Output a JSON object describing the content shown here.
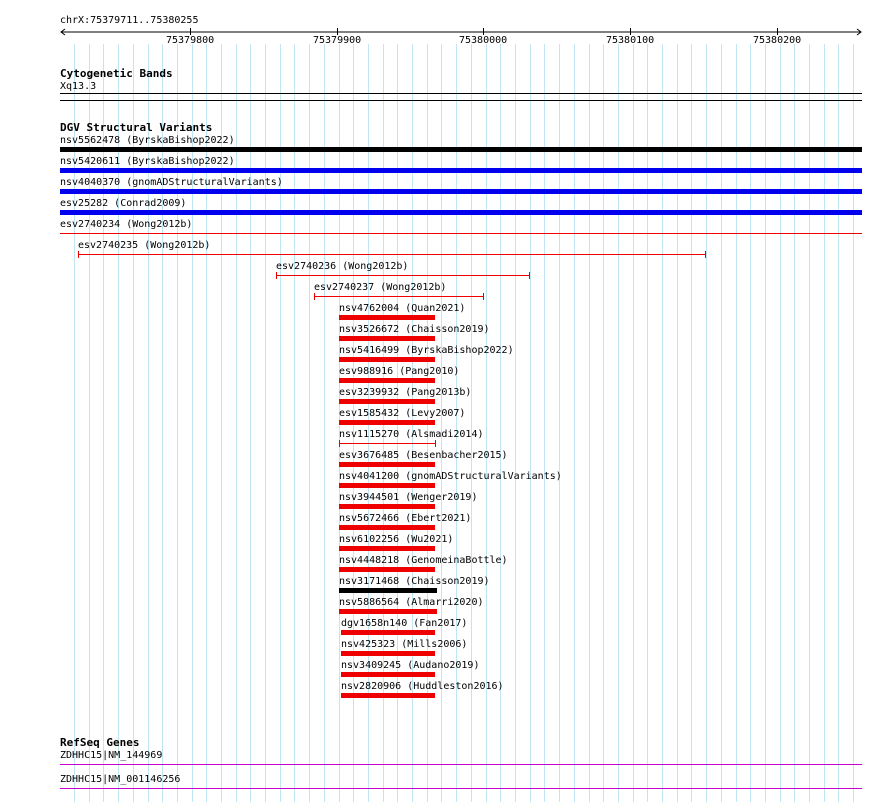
{
  "ruler": {
    "region": "chrX:75379711..75380255",
    "ticks": [
      "75379800",
      "75379900",
      "75380000",
      "75380100",
      "75380200"
    ]
  },
  "cytoband": {
    "title": "Cytogenetic Bands",
    "band": "Xq13.3"
  },
  "dgv": {
    "title": "DGV Structural Variants",
    "variants": [
      {
        "label": "nsv5562478 (ByrskaBishop2022)",
        "color": "#000000",
        "style": "thick"
      },
      {
        "label": "nsv5420611 (ByrskaBishop2022)",
        "color": "#0000ee",
        "style": "thick"
      },
      {
        "label": "nsv4040370 (gnomADStructuralVariants)",
        "color": "#0000ee",
        "style": "thick"
      },
      {
        "label": "esv25282 (Conrad2009)",
        "color": "#0000ee",
        "style": "thick"
      },
      {
        "label": "esv2740234 (Wong2012b)",
        "color": "#ee0000",
        "style": "line"
      },
      {
        "label": "esv2740235 (Wong2012b)",
        "color": "#ee0000",
        "style": "capped"
      },
      {
        "label": "esv2740236 (Wong2012b)",
        "color": "#ee0000",
        "style": "capped"
      },
      {
        "label": "esv2740237 (Wong2012b)",
        "color": "#ee0000",
        "style": "capped"
      },
      {
        "label": "nsv4762004 (Quan2021)",
        "color": "#ee0000",
        "style": "thick"
      },
      {
        "label": "nsv3526672 (Chaisson2019)",
        "color": "#ee0000",
        "style": "thick"
      },
      {
        "label": "nsv5416499 (ByrskaBishop2022)",
        "color": "#ee0000",
        "style": "thick"
      },
      {
        "label": "esv988916 (Pang2010)",
        "color": "#ee0000",
        "style": "thick"
      },
      {
        "label": "esv3239932 (Pang2013b)",
        "color": "#ee0000",
        "style": "thick"
      },
      {
        "label": "esv1585432 (Levy2007)",
        "color": "#ee0000",
        "style": "thick"
      },
      {
        "label": "nsv1115270 (Alsmadi2014)",
        "color": "#ee0000",
        "style": "capped"
      },
      {
        "label": "esv3676485 (Besenbacher2015)",
        "color": "#ee0000",
        "style": "thick"
      },
      {
        "label": "nsv4041200 (gnomADStructuralVariants)",
        "color": "#ee0000",
        "style": "thick"
      },
      {
        "label": "nsv3944501 (Wenger2019)",
        "color": "#ee0000",
        "style": "thick"
      },
      {
        "label": "nsv5672466 (Ebert2021)",
        "color": "#ee0000",
        "style": "thick"
      },
      {
        "label": "nsv6102256 (Wu2021)",
        "color": "#ee0000",
        "style": "thick"
      },
      {
        "label": "nsv4448218 (GenomeinaBottle)",
        "color": "#ee0000",
        "style": "thick"
      },
      {
        "label": "nsv3171468 (Chaisson2019)",
        "color": "#000000",
        "style": "thick"
      },
      {
        "label": "nsv5886564 (Almarri2020)",
        "color": "#ee0000",
        "style": "thick"
      },
      {
        "label": "dgv1658n140 (Fan2017)",
        "color": "#ee0000",
        "style": "thick"
      },
      {
        "label": "nsv425323 (Mills2006)",
        "color": "#ee0000",
        "style": "thick"
      },
      {
        "label": "nsv3409245 (Audano2019)",
        "color": "#ee0000",
        "style": "thick"
      },
      {
        "label": "nsv2820906 (Huddleston2016)",
        "color": "#ee0000",
        "style": "thick"
      }
    ]
  },
  "refseq": {
    "title": "RefSeq Genes",
    "genes": [
      {
        "label": "ZDHHC15|NM_144969",
        "color": "#cc00cc"
      },
      {
        "label": "ZDHHC15|NM_001146256",
        "color": "#cc00cc"
      }
    ]
  }
}
